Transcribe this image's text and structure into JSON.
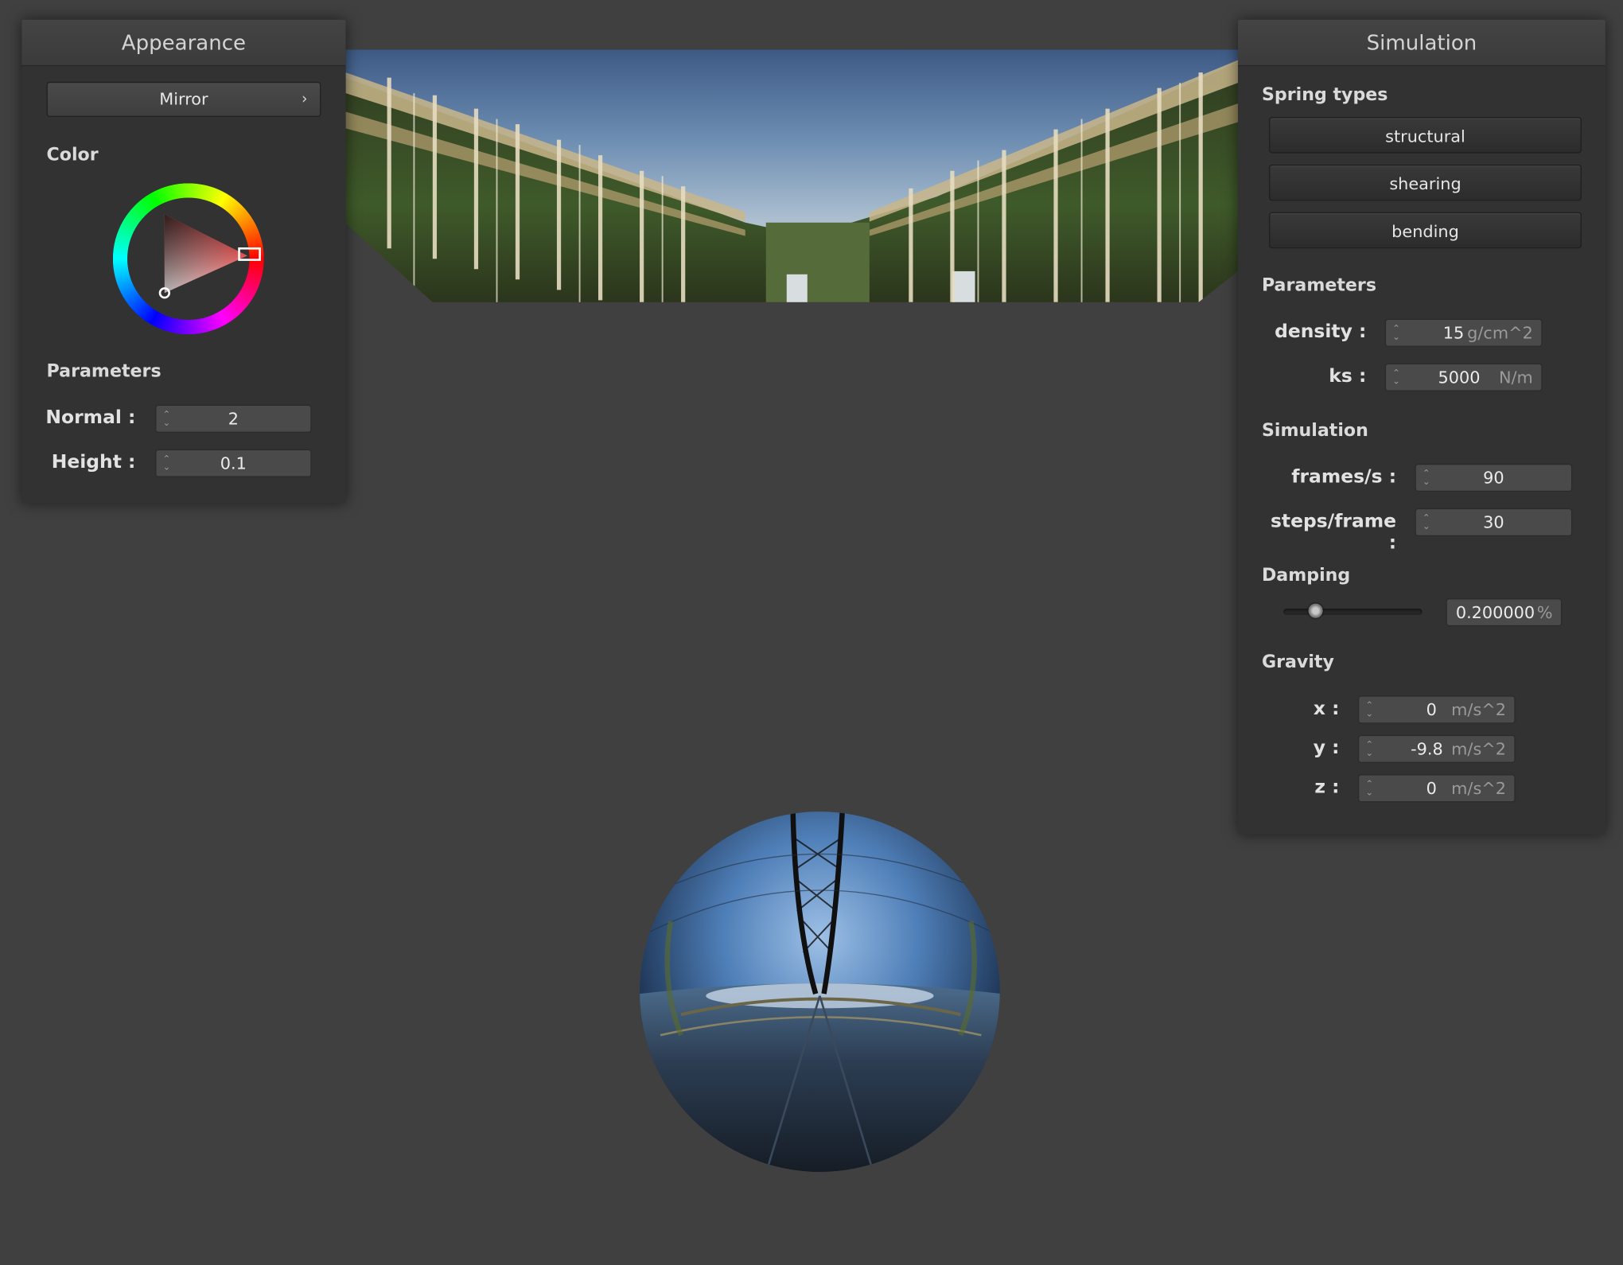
{
  "colors": {
    "background": "#404040",
    "panel": "#323232",
    "selected_color": "#e31b1b"
  },
  "appearance": {
    "title": "Appearance",
    "material_button": "Mirror",
    "chevron_icon": "chevron-right-icon",
    "color_section": "Color",
    "parameters_section": "Parameters",
    "normal_label": "Normal :",
    "normal_value": "2",
    "height_label": "Height :",
    "height_value": "0.1"
  },
  "simulation": {
    "title": "Simulation",
    "spring_types_section": "Spring types",
    "spring_buttons": [
      "structural",
      "shearing",
      "bending"
    ],
    "parameters_section": "Parameters",
    "density_label": "density :",
    "density_value": "15",
    "density_unit": "g/cm^2",
    "ks_label": "ks :",
    "ks_value": "5000",
    "ks_unit": "N/m",
    "sim_section": "Simulation",
    "fps_label": "frames/s :",
    "fps_value": "90",
    "steps_label": "steps/frame :",
    "steps_value": "30",
    "damping_section": "Damping",
    "damping_value": "0.200000",
    "damping_unit": "%",
    "damping_slider_fraction": 0.2,
    "gravity_section": "Gravity",
    "gx_label": "x :",
    "gx_value": "0",
    "gy_label": "y :",
    "gy_value": "-9.8",
    "gz_label": "z :",
    "gz_value": "0",
    "gravity_unit": "m/s^2"
  }
}
